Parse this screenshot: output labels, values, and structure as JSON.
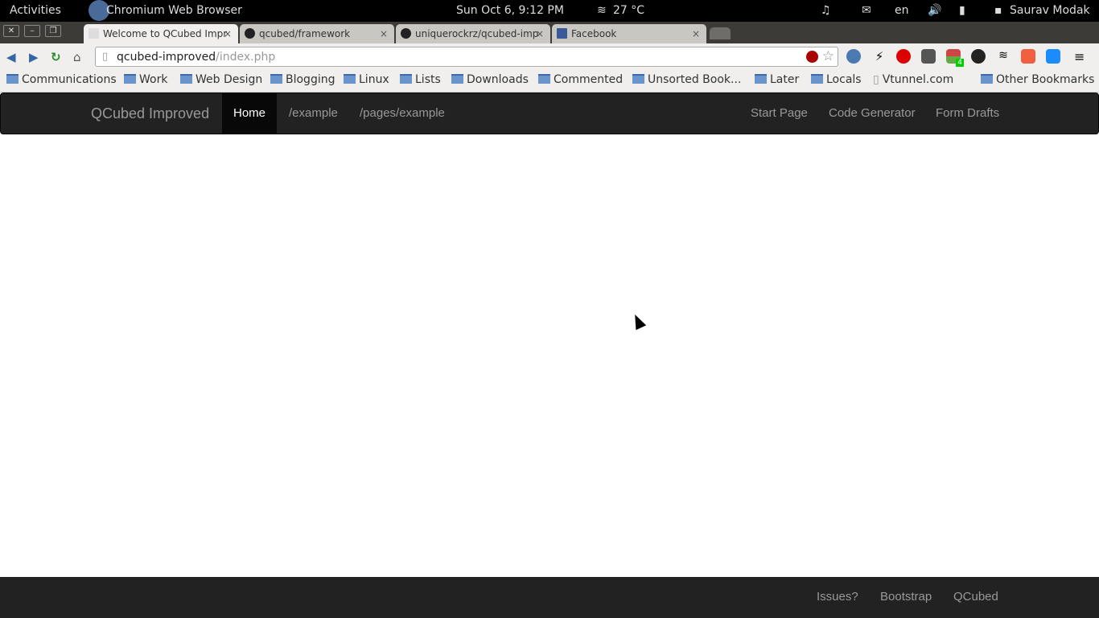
{
  "system": {
    "activities": "Activities",
    "app_name": "Chromium Web Browser",
    "clock": "Sun Oct  6,  9:12 PM",
    "weather": "27 °C",
    "language": "en",
    "user": "Saurav Modak"
  },
  "tabs": [
    {
      "title": "Welcome to QCubed Impr",
      "active": true
    },
    {
      "title": "qcubed/framework"
    },
    {
      "title": "uniquerockrz/qcubed-imp"
    },
    {
      "title": "Facebook"
    }
  ],
  "address": {
    "host": "qcubed-improved",
    "path": "/index.php"
  },
  "extension_badge": "4",
  "bookmarks": [
    "Communications",
    "Work",
    "Web Design",
    "Blogging",
    "Linux",
    "Lists",
    "Downloads",
    "Commented",
    "Unsorted Book...",
    "Later",
    "Locals",
    "Vtunnel.com"
  ],
  "other_bookmarks": "Other Bookmarks",
  "navbar": {
    "brand": "QCubed Improved",
    "left": [
      "Home",
      "/example",
      "/pages/example"
    ],
    "right": [
      "Start Page",
      "Code Generator",
      "Form Drafts"
    ]
  },
  "footer": {
    "links": [
      "Issues?",
      "Bootstrap",
      "QCubed"
    ]
  }
}
